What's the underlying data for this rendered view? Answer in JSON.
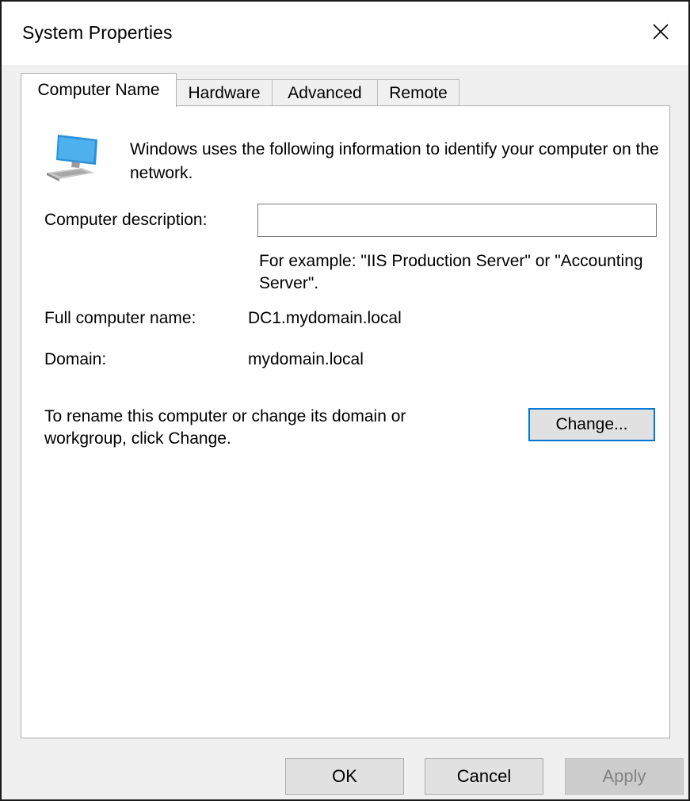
{
  "window": {
    "title": "System Properties"
  },
  "tabs": [
    {
      "label": "Computer Name",
      "active": true
    },
    {
      "label": "Hardware",
      "active": false
    },
    {
      "label": "Advanced",
      "active": false
    },
    {
      "label": "Remote",
      "active": false
    }
  ],
  "computer_name": {
    "intro": "Windows uses the following information to identify your computer on the network.",
    "description_label": "Computer description:",
    "description_value": "",
    "description_hint": "For example: \"IIS Production Server\" or \"Accounting Server\".",
    "full_name_label": "Full computer name:",
    "full_name_value": "DC1.mydomain.local",
    "domain_label": "Domain:",
    "domain_value": "mydomain.local",
    "rename_text": "To rename this computer or change its domain or workgroup, click Change.",
    "change_button": "Change..."
  },
  "footer": {
    "ok": "OK",
    "cancel": "Cancel",
    "apply": "Apply"
  },
  "colors": {
    "focus_border": "#0078d7",
    "dialog_background": "#f0f0f0",
    "panel_background": "#ffffff",
    "disabled_text": "#838383"
  },
  "icons": {
    "close": "close-icon",
    "computer": "computer-icon"
  }
}
